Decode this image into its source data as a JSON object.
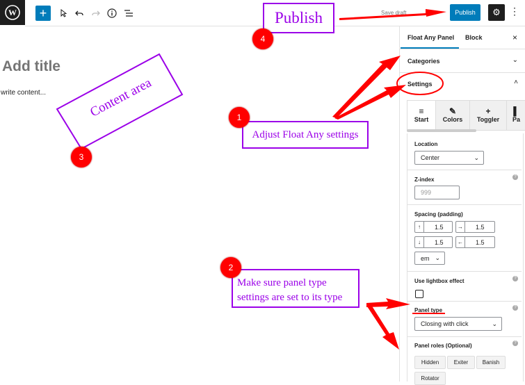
{
  "toolbar": {
    "logo_icon": "wordpress-icon",
    "add_icon": "+",
    "select_icon": "pointer-icon",
    "undo_icon": "undo-icon",
    "redo_icon": "redo-icon",
    "info_icon": "info-icon",
    "outline_icon": "list-view-icon",
    "save_draft": "Save draft",
    "publish": "Publish",
    "settings_icon": "gear-icon",
    "more_icon": "more-vertical-icon"
  },
  "editor": {
    "title_placeholder": "Add title",
    "content_placeholder": "write content..."
  },
  "sidebar": {
    "tabs": [
      "Float Any Panel",
      "Block"
    ],
    "close": "×",
    "panels": {
      "categories": "Categories",
      "settings": "Settings"
    },
    "inner_tabs": [
      {
        "label": "Start",
        "icon": "≡"
      },
      {
        "label": "Colors",
        "icon": "✎"
      },
      {
        "label": "Toggler",
        "icon": "+"
      },
      {
        "label": "Pa",
        "icon": "▌"
      }
    ],
    "location": {
      "label": "Location",
      "value": "Center"
    },
    "zindex": {
      "label": "Z-index",
      "placeholder": "999"
    },
    "spacing": {
      "label": "Spacing (padding)",
      "top": "1.5",
      "right": "1.5",
      "bottom": "1.5",
      "left": "1.5",
      "unit": "em"
    },
    "lightbox": {
      "label": "Use lightbox effect"
    },
    "panel_type": {
      "label": "Panel type",
      "value": "Closing with click"
    },
    "panel_roles": {
      "label": "Panel roles (Optional)",
      "buttons": [
        "Hidden",
        "Exiter",
        "Banish",
        "Rotator"
      ]
    }
  },
  "annotations": {
    "publish": "Publish",
    "content_area": "Content area",
    "float_any": "Adjust Float Any settings",
    "panel_type_line1": "Make sure panel type",
    "panel_type_line2": "settings are set to its type",
    "badges": [
      "1",
      "2",
      "3",
      "4"
    ]
  },
  "colors": {
    "accent": "#007cba",
    "annotation": "#9b00e8",
    "marker": "#ff0000"
  }
}
